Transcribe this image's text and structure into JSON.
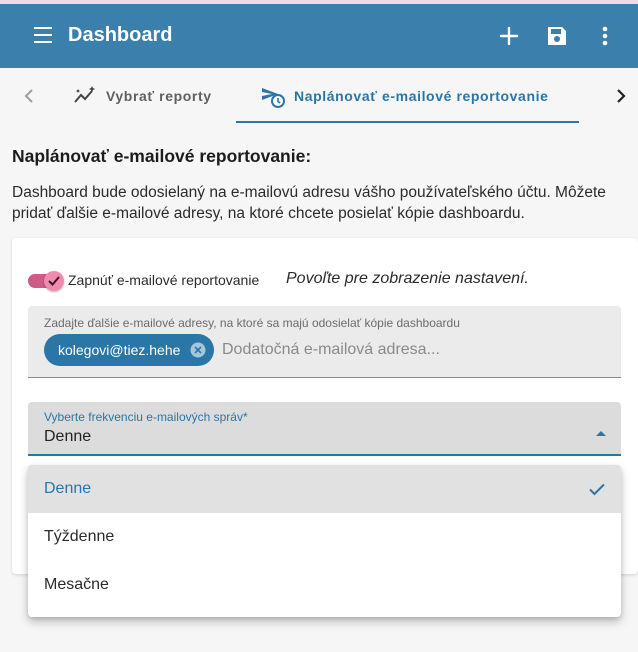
{
  "colors": {
    "primary": "#3b7fac",
    "accent": "#2a76a6",
    "toggle": "#cd5c86",
    "chip": "#2a76a6"
  },
  "appbar": {
    "title": "Dashboard",
    "icons": [
      "menu-icon",
      "add-icon",
      "save-icon",
      "more-vert-icon"
    ]
  },
  "tabs": [
    {
      "label": "Vybrať reporty",
      "icon": "chart-sparkle-icon",
      "active": false
    },
    {
      "label": "Naplánovať e-mailové reportovanie",
      "icon": "schedule-send-icon",
      "active": true
    }
  ],
  "section": {
    "heading": "Naplánovať e-mailové reportovanie:",
    "description": "Dashboard bude odosielaný na e-mailovú adresu vášho používateľského účtu. Môžete pridať ďalšie e-mailové adresy, na ktoré chcete posielať kópie dashboardu."
  },
  "toggle": {
    "label": "Zapnúť e-mailové reportovanie",
    "checked": true,
    "hint": "Povoľte pre zobrazenie nastavení."
  },
  "emails": {
    "label": "Zadajte ďalšie e-mailové adresy, na ktoré sa majú odosielať kópie dashboardu",
    "chips": [
      "kolegovi@tiez.hehe"
    ],
    "placeholder": "Dodatočná e-mailová adresa..."
  },
  "frequency": {
    "label": "Vyberte frekvenciu e-mailových správ*",
    "value": "Denne",
    "options": [
      {
        "label": "Denne",
        "selected": true
      },
      {
        "label": "Týždenne",
        "selected": false
      },
      {
        "label": "Mesačne",
        "selected": false
      }
    ]
  }
}
